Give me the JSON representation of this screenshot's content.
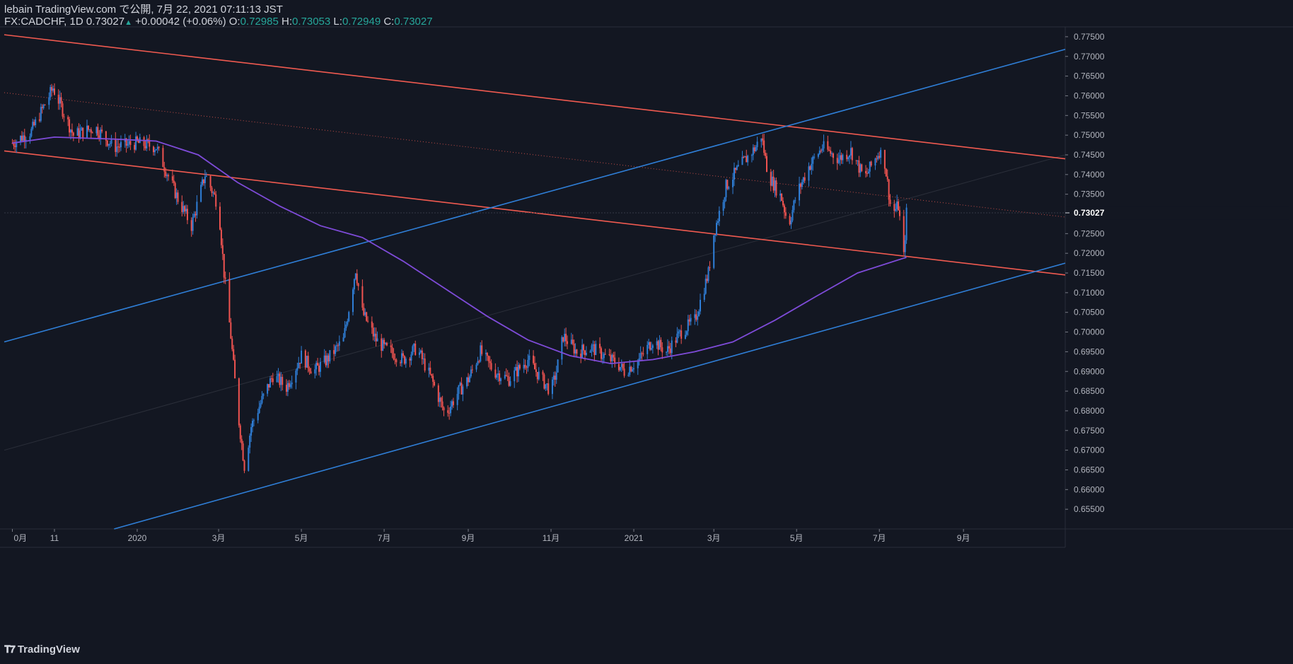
{
  "header": {
    "author": "lebain",
    "published": "TradingView.com で公開, 7月 22, 2021 07:11:13 JST",
    "symbol": "FX:CADCHF, 1D",
    "last": "0.73027",
    "arrow": "▲",
    "change": "+0.00042 (+0.06%)",
    "o_label": "O:",
    "o": "0.72985",
    "h_label": "H:",
    "h": "0.73053",
    "l_label": "L:",
    "l": "0.72949",
    "c_label": "C:",
    "c": "0.73027"
  },
  "footer": {
    "brand": "TradingView",
    "logo": "tradingview-logo-icon"
  },
  "colors": {
    "background": "#131722",
    "up": "#2f7fd8",
    "down": "#ef5350",
    "channel_red": "#f05a50",
    "channel_blue": "#2f7fd8",
    "ma": "#7e4bd8",
    "text": "#b2b5be",
    "price_tag_bg": "#131722"
  },
  "chart_data": {
    "type": "candlestick",
    "ylim": [
      0.65,
      0.7775
    ],
    "y_ticks": [
      "0.77500",
      "0.77000",
      "0.76500",
      "0.76000",
      "0.75500",
      "0.75000",
      "0.74500",
      "0.74000",
      "0.73500",
      "0.72500",
      "0.72000",
      "0.71500",
      "0.71000",
      "0.70500",
      "0.70000",
      "0.69500",
      "0.69000",
      "0.68500",
      "0.68000",
      "0.67500",
      "0.67000",
      "0.66500",
      "0.66000",
      "0.65500"
    ],
    "x_ticks": [
      "0月",
      "11",
      "2020",
      "3月",
      "5月",
      "7月",
      "9月",
      "11月",
      "2021",
      "3月",
      "5月",
      "7月",
      "9月"
    ],
    "last_price": "0.73027",
    "close_series": [
      [
        "2019-10-01",
        0.748
      ],
      [
        "2019-10-15",
        0.751
      ],
      [
        "2019-10-31",
        0.762
      ],
      [
        "2019-11-15",
        0.75
      ],
      [
        "2019-12-01",
        0.752
      ],
      [
        "2019-12-15",
        0.747
      ],
      [
        "2020-01-01",
        0.748
      ],
      [
        "2020-01-15",
        0.747
      ],
      [
        "2020-02-01",
        0.733
      ],
      [
        "2020-02-10",
        0.727
      ],
      [
        "2020-02-20",
        0.74
      ],
      [
        "2020-03-01",
        0.732
      ],
      [
        "2020-03-05",
        0.715
      ],
      [
        "2020-03-10",
        0.699
      ],
      [
        "2020-03-15",
        0.68
      ],
      [
        "2020-03-20",
        0.666
      ],
      [
        "2020-03-25",
        0.676
      ],
      [
        "2020-04-01",
        0.682
      ],
      [
        "2020-04-10",
        0.689
      ],
      [
        "2020-04-20",
        0.686
      ],
      [
        "2020-05-01",
        0.694
      ],
      [
        "2020-05-10",
        0.69
      ],
      [
        "2020-05-20",
        0.693
      ],
      [
        "2020-06-01",
        0.698
      ],
      [
        "2020-06-10",
        0.716
      ],
      [
        "2020-06-15",
        0.705
      ],
      [
        "2020-06-25",
        0.698
      ],
      [
        "2020-07-01",
        0.696
      ],
      [
        "2020-07-15",
        0.693
      ],
      [
        "2020-07-25",
        0.696
      ],
      [
        "2020-08-05",
        0.688
      ],
      [
        "2020-08-15",
        0.679
      ],
      [
        "2020-08-25",
        0.685
      ],
      [
        "2020-09-01",
        0.688
      ],
      [
        "2020-09-10",
        0.695
      ],
      [
        "2020-09-20",
        0.69
      ],
      [
        "2020-10-01",
        0.688
      ],
      [
        "2020-10-15",
        0.693
      ],
      [
        "2020-10-25",
        0.688
      ],
      [
        "2020-11-01",
        0.685
      ],
      [
        "2020-11-05",
        0.69
      ],
      [
        "2020-11-10",
        0.699
      ],
      [
        "2020-11-20",
        0.695
      ],
      [
        "2020-12-01",
        0.696
      ],
      [
        "2020-12-10",
        0.694
      ],
      [
        "2020-12-20",
        0.692
      ],
      [
        "2020-12-25",
        0.69
      ],
      [
        "2021-01-05",
        0.693
      ],
      [
        "2021-01-15",
        0.698
      ],
      [
        "2021-01-25",
        0.695
      ],
      [
        "2021-02-05",
        0.7
      ],
      [
        "2021-02-15",
        0.703
      ],
      [
        "2021-02-25",
        0.715
      ],
      [
        "2021-03-01",
        0.725
      ],
      [
        "2021-03-10",
        0.737
      ],
      [
        "2021-03-20",
        0.742
      ],
      [
        "2021-04-01",
        0.747
      ],
      [
        "2021-04-05",
        0.75
      ],
      [
        "2021-04-10",
        0.74
      ],
      [
        "2021-04-20",
        0.734
      ],
      [
        "2021-04-25",
        0.727
      ],
      [
        "2021-05-01",
        0.735
      ],
      [
        "2021-05-10",
        0.742
      ],
      [
        "2021-05-20",
        0.747
      ],
      [
        "2021-06-01",
        0.744
      ],
      [
        "2021-06-10",
        0.746
      ],
      [
        "2021-06-20",
        0.739
      ],
      [
        "2021-07-01",
        0.746
      ],
      [
        "2021-07-05",
        0.743
      ],
      [
        "2021-07-10",
        0.73
      ],
      [
        "2021-07-15",
        0.732
      ],
      [
        "2021-07-19",
        0.719
      ],
      [
        "2021-07-21",
        0.7303
      ]
    ],
    "ma_series": [
      [
        "2019-10-01",
        0.748
      ],
      [
        "2019-11-01",
        0.7495
      ],
      [
        "2019-12-15",
        0.749
      ],
      [
        "2020-01-15",
        0.7485
      ],
      [
        "2020-02-15",
        0.745
      ],
      [
        "2020-03-15",
        0.738
      ],
      [
        "2020-04-15",
        0.732
      ],
      [
        "2020-05-15",
        0.727
      ],
      [
        "2020-06-15",
        0.724
      ],
      [
        "2020-07-15",
        0.718
      ],
      [
        "2020-08-15",
        0.711
      ],
      [
        "2020-09-15",
        0.704
      ],
      [
        "2020-10-15",
        0.698
      ],
      [
        "2020-11-15",
        0.694
      ],
      [
        "2020-12-15",
        0.692
      ],
      [
        "2021-01-15",
        0.693
      ],
      [
        "2021-02-15",
        0.695
      ],
      [
        "2021-03-15",
        0.6975
      ],
      [
        "2021-04-15",
        0.703
      ],
      [
        "2021-05-15",
        0.709
      ],
      [
        "2021-06-15",
        0.715
      ],
      [
        "2021-07-21",
        0.719
      ]
    ],
    "trendlines": [
      {
        "color": "red",
        "style": "solid",
        "from": [
          "2019-09-25",
          0.7755
        ],
        "to": [
          "2021-11-15",
          0.744
        ]
      },
      {
        "color": "red",
        "style": "solid",
        "from": [
          "2019-09-25",
          0.746
        ],
        "to": [
          "2021-11-15",
          0.7145
        ]
      },
      {
        "color": "red",
        "style": "dotted",
        "from": [
          "2019-09-25",
          0.7608
        ],
        "to": [
          "2021-11-15",
          0.7292
        ]
      },
      {
        "color": "blue",
        "style": "solid",
        "from": [
          "2019-09-25",
          0.6975
        ],
        "to": [
          "2021-11-15",
          0.7718
        ]
      },
      {
        "color": "blue",
        "style": "solid",
        "from": [
          "2019-12-15",
          0.65
        ],
        "to": [
          "2021-11-15",
          0.7175
        ]
      }
    ]
  }
}
